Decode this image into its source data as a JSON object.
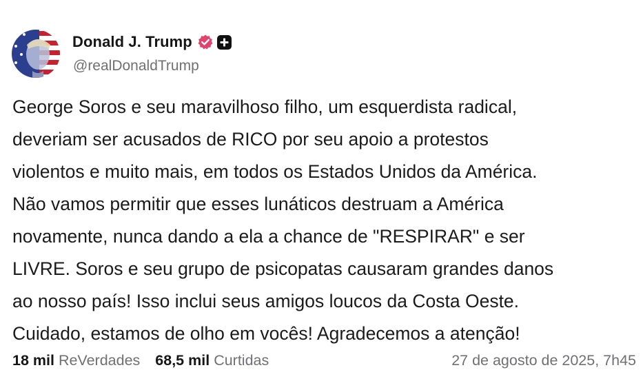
{
  "author": {
    "display_name": "Donald J. Trump",
    "handle": "@realDonaldTrump"
  },
  "post": {
    "lines": [
      "George Soros e seu maravilhoso filho, um esquerdista radical,",
      "deveriam ser acusados de RICO por seu apoio a protestos",
      "violentos e muito mais, em todos os Estados Unidos da América.",
      "Não vamos permitir que esses lunáticos destruam a América",
      "novamente, nunca dando a ela a chance de \"RESPIRAR\" e ser",
      "LIVRE. Soros e seu grupo de psicopatas causaram grandes danos",
      "ao nosso país! Isso inclui seus amigos loucos da Costa Oeste.",
      "Cuidado, estamos de olho em vocês! Agradecemos a atenção!"
    ]
  },
  "stats": {
    "reposts_count": "18 mil",
    "reposts_label": "ReVerdades",
    "likes_count": "68,5 mil",
    "likes_label": "Curtidas"
  },
  "timestamp": "27 de agosto de 2025, 7h45",
  "icons": {
    "verified": "verified-badge-icon",
    "plus": "plus-badge-icon"
  },
  "colors": {
    "verified_badge": "#e0446d",
    "secondary_text": "#6f6f76",
    "primary_text": "#161616"
  }
}
